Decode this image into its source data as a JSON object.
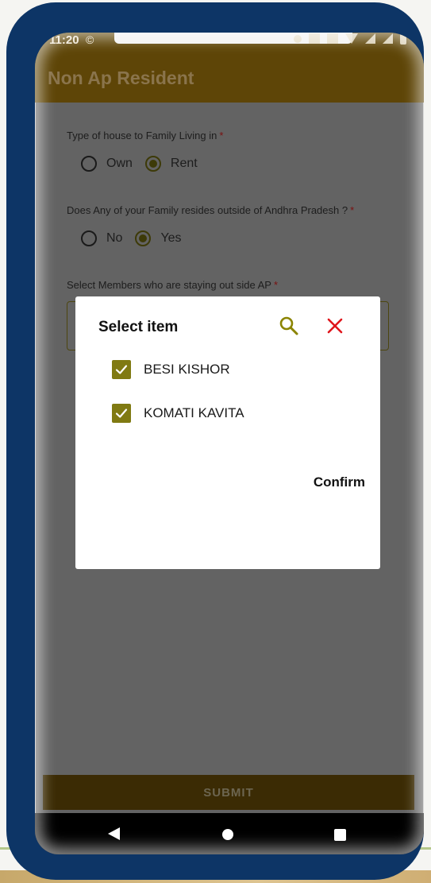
{
  "status_bar": {
    "time": "11:20",
    "whatsapp_glyph": "©"
  },
  "app_bar": {
    "title": "Non Ap Resident"
  },
  "form": {
    "house_type": {
      "label": "Type of house to Family Living in",
      "required_mark": "*",
      "options": [
        {
          "label": "Own",
          "selected": false
        },
        {
          "label": "Rent",
          "selected": true
        }
      ]
    },
    "outside_ap": {
      "label": "Does Any of your Family resides outside of Andhra Pradesh ?",
      "required_mark": "*",
      "options": [
        {
          "label": "No",
          "selected": false
        },
        {
          "label": "Yes",
          "selected": true
        }
      ]
    },
    "members": {
      "label": "Select Members who are staying out side AP",
      "required_mark": "*"
    }
  },
  "submit": {
    "label": "SUBMIT"
  },
  "dialog": {
    "title": "Select item",
    "items": [
      {
        "label": "BESI KISHOR",
        "checked": true
      },
      {
        "label": "KOMATI KAVITA",
        "checked": true
      }
    ],
    "confirm_label": "Confirm"
  },
  "colors": {
    "frame": "#0d3566",
    "app_bar": "#5e4507",
    "overlay": "#636363",
    "checkbox": "#807a12",
    "search_icon": "#8b8400",
    "close_icon": "#e0151b",
    "submit": "#3b2b04"
  },
  "icons": {
    "search": "search-icon",
    "close": "close-icon",
    "check": "check-icon",
    "nav_back": "back-triangle-icon",
    "nav_home": "home-circle-icon",
    "nav_recents": "recents-square-icon"
  }
}
